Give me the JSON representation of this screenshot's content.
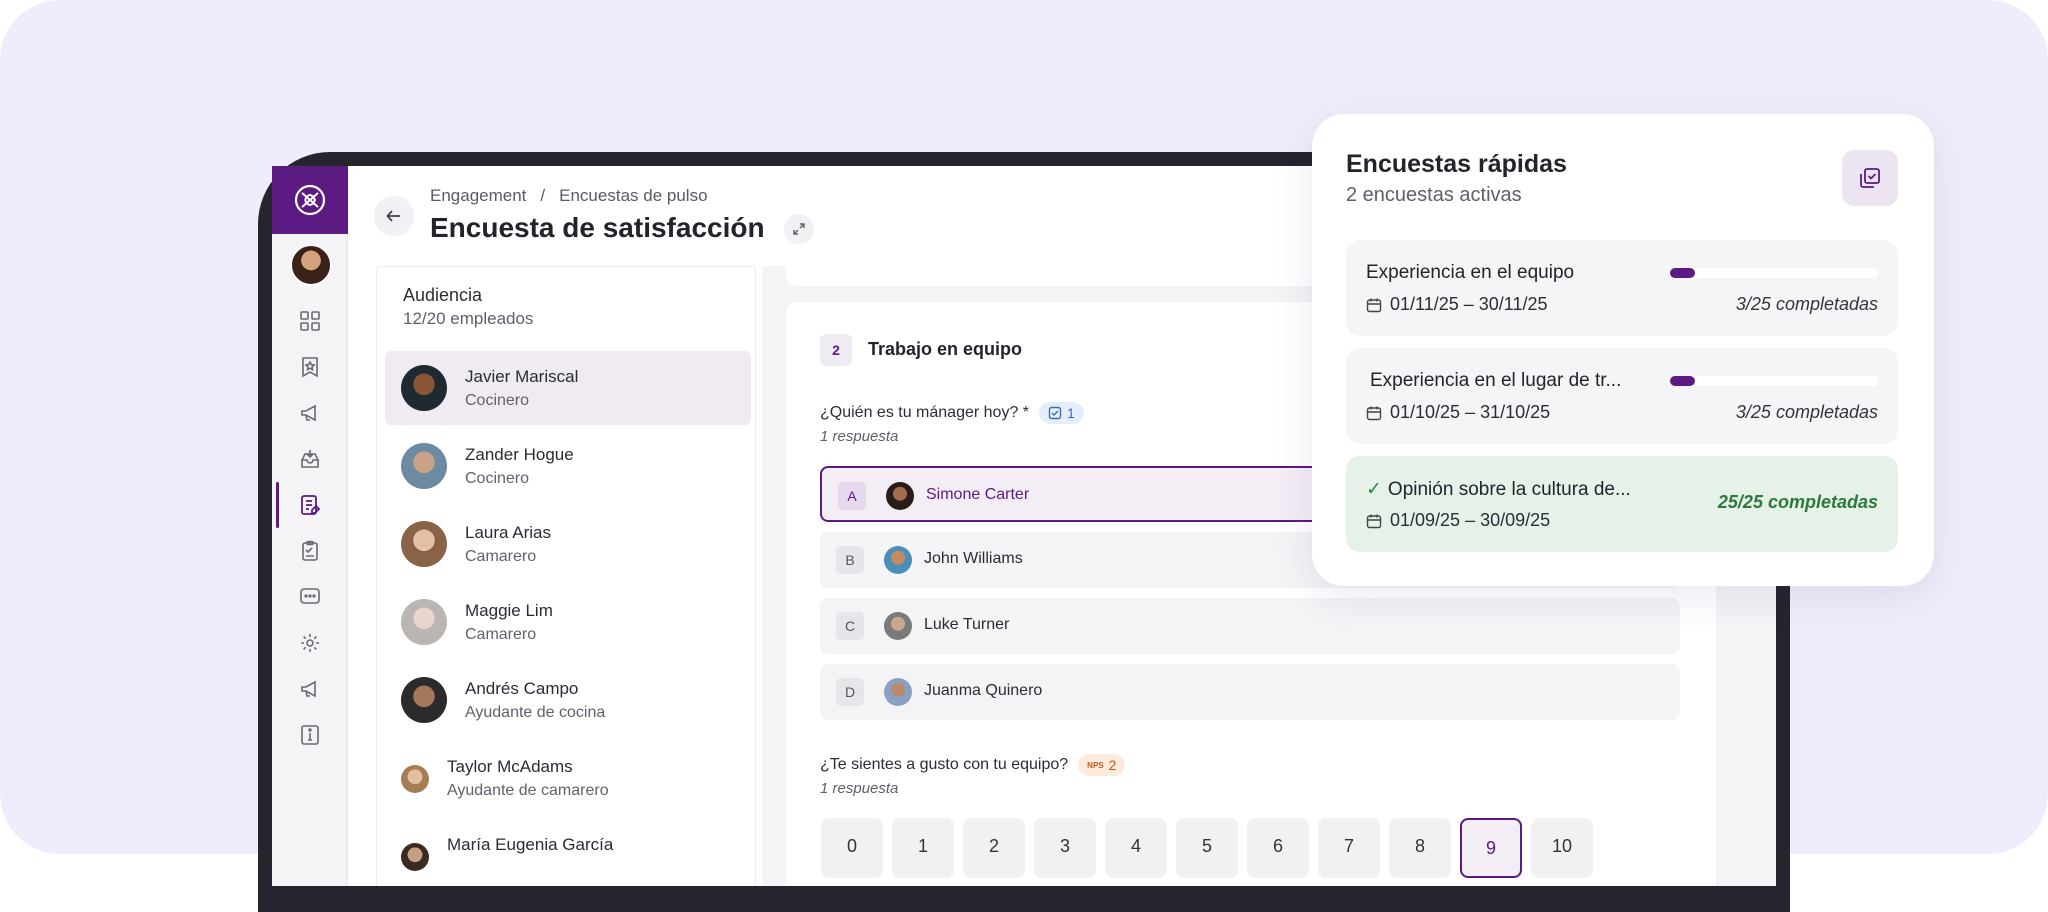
{
  "breadcrumb": {
    "root": "Engagement",
    "separator": "/",
    "current": "Encuestas de pulso"
  },
  "page_title": "Encuesta de satisfacción",
  "audience": {
    "title": "Audiencia",
    "count": "12/20 empleados",
    "employees": [
      {
        "name": "Javier Mariscal",
        "role": "Cocinero"
      },
      {
        "name": "Zander Hogue",
        "role": "Cocinero"
      },
      {
        "name": "Laura Arias",
        "role": "Camarero"
      },
      {
        "name": "Maggie Lim",
        "role": "Camarero"
      },
      {
        "name": "Andrés Campo",
        "role": "Ayudante de cocina"
      },
      {
        "name": "Taylor McAdams",
        "role": "Ayudante de camarero"
      },
      {
        "name": "María Eugenia García",
        "role": ""
      }
    ]
  },
  "section": {
    "number": "2",
    "title": "Trabajo en equipo"
  },
  "question1": {
    "label": "¿Quién es tu mánager hoy? *",
    "chip": "1",
    "responses": "1 respuesta",
    "options": [
      {
        "letter": "A",
        "name": "Simone Carter"
      },
      {
        "letter": "B",
        "name": "John Williams"
      },
      {
        "letter": "C",
        "name": "Luke Turner"
      },
      {
        "letter": "D",
        "name": "Juanma Quinero"
      }
    ]
  },
  "question2": {
    "label": "¿Te sientes a gusto con tu equipo?",
    "chip_tag": "NPS",
    "chip": "2",
    "responses": "1 respuesta",
    "scale": [
      "0",
      "1",
      "2",
      "3",
      "4",
      "5",
      "6",
      "7",
      "8",
      "9",
      "10"
    ],
    "selected": "9"
  },
  "quick_surveys": {
    "title": "Encuestas rápidas",
    "subtitle": "2 encuestas activas",
    "items": [
      {
        "title": "Experiencia en el equipo",
        "dates": "01/11/25 – 30/11/25",
        "completed": "3/25 completadas",
        "progress": 0.12
      },
      {
        "title": "Experiencia en el lugar de tr...",
        "dates": "01/10/25 – 31/10/25",
        "completed": "3/25 completadas",
        "progress": 0.12
      },
      {
        "title": "Opinión sobre la cultura de...",
        "dates": "01/09/25 – 30/09/25",
        "completed": "25/25 completadas",
        "progress": 1.0
      }
    ]
  },
  "colors": {
    "brand": "#5c1a83",
    "success": "#2b7a3b",
    "canvas": "#efedfb"
  }
}
